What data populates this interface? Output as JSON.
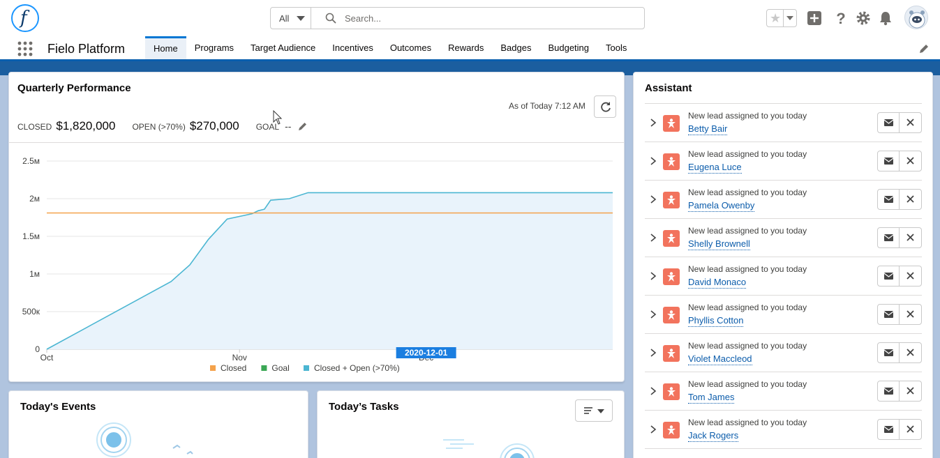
{
  "header": {
    "logo_letter": "f",
    "search": {
      "scope": "All",
      "placeholder": "Search..."
    }
  },
  "nav": {
    "app_name": "Fielo Platform",
    "tabs": [
      {
        "label": "Home",
        "active": true
      },
      {
        "label": "Programs"
      },
      {
        "label": "Target Audience"
      },
      {
        "label": "Incentives"
      },
      {
        "label": "Outcomes"
      },
      {
        "label": "Rewards"
      },
      {
        "label": "Badges"
      },
      {
        "label": "Budgeting"
      },
      {
        "label": "Tools"
      }
    ]
  },
  "quarterly": {
    "title": "Quarterly Performance",
    "as_of": "As of Today 7:12 AM",
    "closed_label": "CLOSED",
    "closed_value": "$1,820,000",
    "open_label": "OPEN (>70%)",
    "open_value": "$270,000",
    "goal_label": "GOAL",
    "goal_value": "--"
  },
  "chart_data": {
    "type": "area",
    "title": "",
    "xlabel": "",
    "ylabel": "",
    "x_ticks": [
      "Oct",
      "Nov",
      "Dec"
    ],
    "y_ticks": [
      "0",
      "500к",
      "1м",
      "1.5м",
      "2м",
      "2.5м"
    ],
    "ylim": [
      0,
      2500000
    ],
    "xlim": [
      "2020-10-01",
      "2020-12-31"
    ],
    "grid": true,
    "legend": "bottom",
    "highlight_label": "2020-12-01",
    "series": [
      {
        "name": "Closed + Open (>70%)",
        "color": "#4bb6d2",
        "points": [
          [
            "2020-10-01",
            0
          ],
          [
            "2020-10-21",
            900000
          ],
          [
            "2020-10-24",
            1120000
          ],
          [
            "2020-10-27",
            1460000
          ],
          [
            "2020-10-30",
            1730000
          ],
          [
            "2020-11-03",
            1800000
          ],
          [
            "2020-11-04",
            1840000
          ],
          [
            "2020-11-05",
            1860000
          ],
          [
            "2020-11-06",
            1980000
          ],
          [
            "2020-11-09",
            2000000
          ],
          [
            "2020-11-12",
            2080000
          ],
          [
            "2020-12-31",
            2080000
          ]
        ]
      },
      {
        "name": "Goal",
        "color": "#3ba755",
        "points": []
      },
      {
        "name": "Closed",
        "color": "#f4a24b",
        "points": [
          [
            "2020-10-01",
            1810000
          ],
          [
            "2020-12-31",
            1810000
          ]
        ]
      }
    ],
    "legend_items": [
      {
        "name": "Closed",
        "color": "#f4a24b"
      },
      {
        "name": "Goal",
        "color": "#3ba755"
      },
      {
        "name": "Closed + Open (>70%)",
        "color": "#4bb6d2"
      }
    ]
  },
  "assistant": {
    "title": "Assistant",
    "subtitle": "New lead assigned to you today",
    "items": [
      {
        "name": "Betty Bair"
      },
      {
        "name": "Eugena Luce"
      },
      {
        "name": "Pamela Owenby"
      },
      {
        "name": "Shelly Brownell"
      },
      {
        "name": "David Monaco"
      },
      {
        "name": "Phyllis Cotton"
      },
      {
        "name": "Violet Maccleod"
      },
      {
        "name": "Tom James"
      },
      {
        "name": "Jack Rogers"
      }
    ]
  },
  "events": {
    "title": "Today's Events"
  },
  "tasks": {
    "title": "Today’s Tasks"
  }
}
